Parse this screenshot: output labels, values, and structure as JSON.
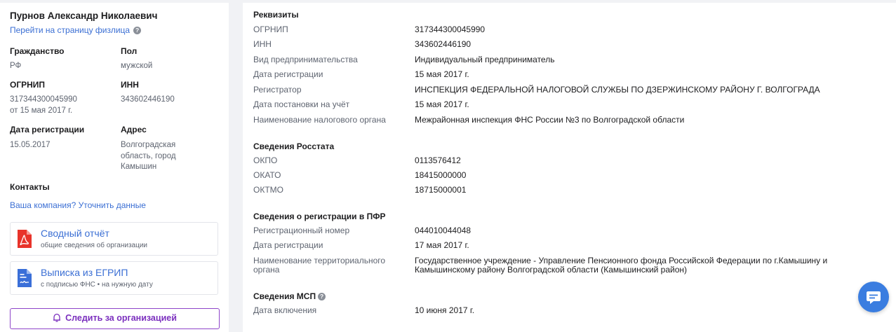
{
  "person": {
    "name": "Пурнов Александр Николаевич",
    "link": "Перейти на страницу физлица"
  },
  "fields": {
    "citizenship_label": "Гражданство",
    "citizenship_value": "РФ",
    "sex_label": "Пол",
    "sex_value": "мужской",
    "ogrnip_label": "ОГРНИП",
    "ogrnip_value": "317344300045990",
    "ogrnip_date": "от 15 мая 2017 г.",
    "inn_label": "ИНН",
    "inn_value": "343602446190",
    "reg_date_label": "Дата регистрации",
    "reg_date_value": "15.05.2017",
    "address_label": "Адрес",
    "address_line1": "Волгоградская",
    "address_line2": "область, город",
    "address_line3": "Камышин"
  },
  "contacts": {
    "label": "Контакты",
    "link": "Ваша компания? Уточнить данные"
  },
  "docs": [
    {
      "title": "Сводный отчёт",
      "subtitle": "общие сведения об организации"
    },
    {
      "title": "Выписка из ЕГРИП",
      "subtitle": "с подписью ФНС • на нужную дату"
    }
  ],
  "follow_button": "Следить за организацией",
  "requisites": {
    "title": "Реквизиты",
    "rows": [
      {
        "k": "ОГРНИП",
        "v": "317344300045990"
      },
      {
        "k": "ИНН",
        "v": "343602446190"
      },
      {
        "k": "Вид предпринимательства",
        "v": "Индивидуальный предприниматель"
      },
      {
        "k": "Дата регистрации",
        "v": "15 мая 2017 г."
      },
      {
        "k": "Регистратор",
        "v": "ИНСПЕКЦИЯ ФЕДЕРАЛЬНОЙ НАЛОГОВОЙ СЛУЖБЫ ПО ДЗЕРЖИНСКОМУ РАЙОНУ Г. ВОЛГОГРАДА"
      },
      {
        "k": "Дата постановки на учёт",
        "v": "15 мая 2017 г."
      },
      {
        "k": "Наименование налогового органа",
        "v": "Межрайонная инспекция ФНС России №3 по Волгоградской области"
      }
    ]
  },
  "rosstat": {
    "title": "Сведения Росстата",
    "rows": [
      {
        "k": "ОКПО",
        "v": "0113576412"
      },
      {
        "k": "ОКАТО",
        "v": "18415000000"
      },
      {
        "k": "ОКТМО",
        "v": "18715000001"
      }
    ]
  },
  "pfr": {
    "title": "Сведения о регистрации в ПФР",
    "rows": [
      {
        "k": "Регистрационный номер",
        "v": "044010044048"
      },
      {
        "k": "Дата регистрации",
        "v": "17 мая 2017 г."
      },
      {
        "k1": "Наименование территориального",
        "k2": "органа",
        "v1": "Государственное учреждение - Управление Пенсионного фонда Российской Федерации по г.Камышину и",
        "v2": "Камышинскому району Волгоградской области (Камышинский район)"
      }
    ]
  },
  "msp": {
    "title": "Сведения МСП",
    "rows": [
      {
        "k": "Дата включения",
        "v": "10 июня 2017 г."
      }
    ]
  },
  "colors": {
    "link": "#3b6fd4",
    "follow": "#7b2fbe",
    "chat": "#3a7de0",
    "pdf": "#e8332a",
    "doc": "#3a6fd8"
  },
  "icons": [
    "info-icon",
    "pdf-icon",
    "document-signature-icon",
    "bell-icon",
    "chat-icon"
  ]
}
